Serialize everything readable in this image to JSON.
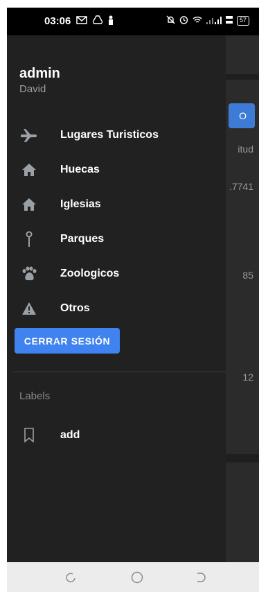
{
  "status_bar": {
    "time": "03:06",
    "left_icons": [
      "gmail-icon",
      "drive-icon",
      "person-icon"
    ],
    "right_icons": [
      "mute-icon",
      "alarm-icon",
      "wifi-icon",
      "signal-icon",
      "speed-icon"
    ],
    "battery": "57"
  },
  "background_app": {
    "button_label": "O",
    "texts": [
      "itud",
      ".7741",
      "85",
      "12"
    ]
  },
  "drawer": {
    "user": {
      "name": "admin",
      "subtitle": "David"
    },
    "items": [
      {
        "label": "Lugares Turisticos",
        "icon": "airplane-icon"
      },
      {
        "label": "Huecas",
        "icon": "home-icon"
      },
      {
        "label": "Iglesias",
        "icon": "home-icon"
      },
      {
        "label": "Parques",
        "icon": "pin-icon"
      },
      {
        "label": "Zoologicos",
        "icon": "paw-icon"
      },
      {
        "label": "Otros",
        "icon": "warning-icon"
      }
    ],
    "logout_label": "CERRAR SESIÓN",
    "labels_title": "Labels",
    "label_items": [
      {
        "label": "add",
        "icon": "bookmark-icon"
      }
    ]
  },
  "colors": {
    "drawer_bg": "#212121",
    "accent": "#3f82f0",
    "icon": "#9aa0a6"
  }
}
